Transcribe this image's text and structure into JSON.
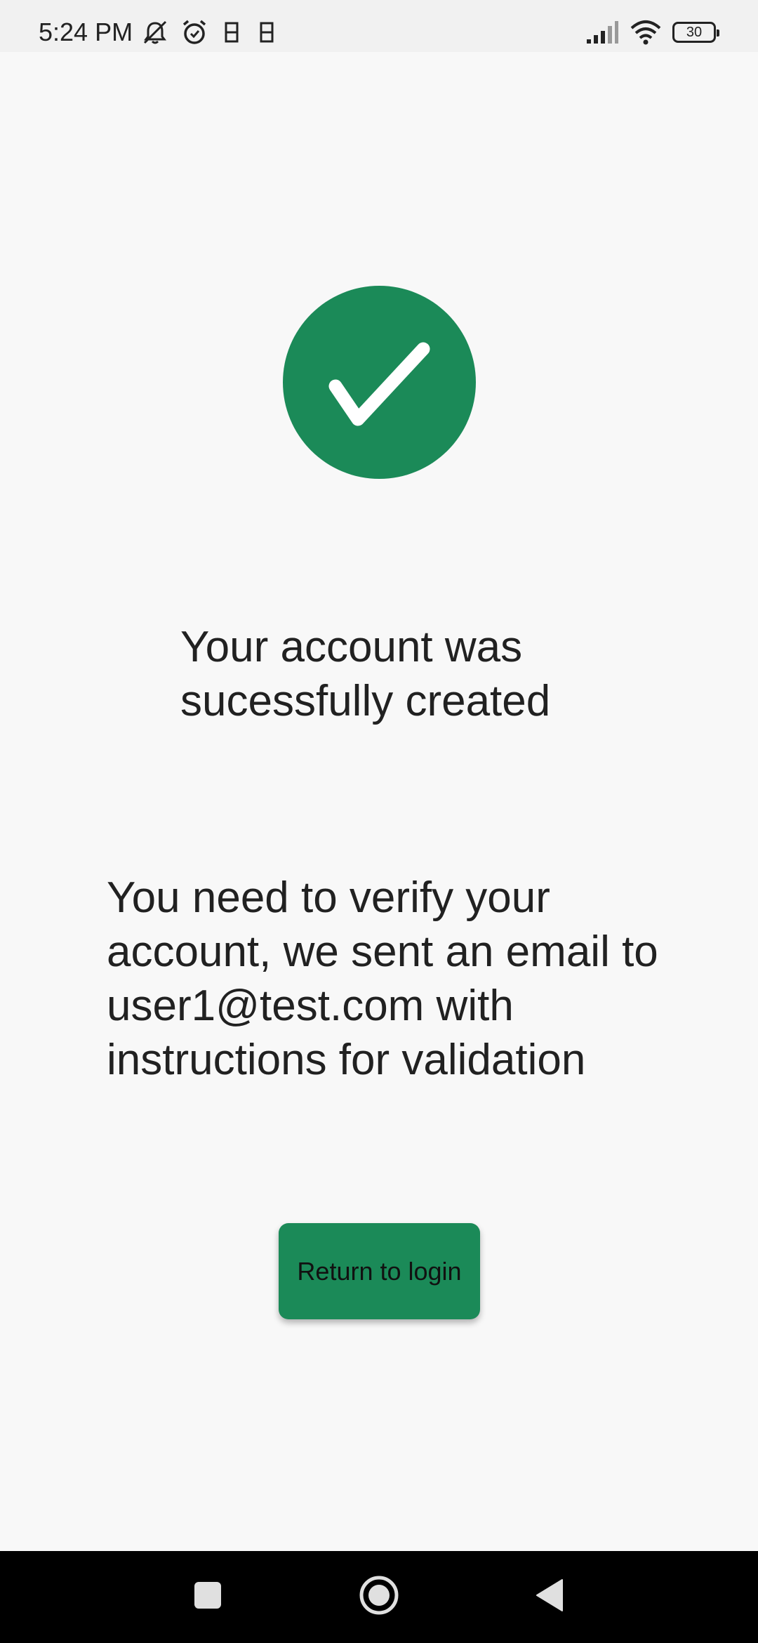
{
  "status_bar": {
    "time": "5:24 PM",
    "battery_level": "30",
    "left_icons": [
      "bell-off-icon",
      "alarm-icon",
      "sim-icon",
      "sim-icon"
    ],
    "right_icons": [
      "signal-icon",
      "wifi-icon",
      "battery-icon"
    ]
  },
  "success": {
    "icon": "check-circle-icon",
    "color": "#1b8a58"
  },
  "title": "Your account was sucessfully created",
  "message": "You need to verify your account, we sent an email to user1@test.com with instructions for validation",
  "actions": {
    "return_label": "Return to login"
  },
  "nav_bar": {
    "buttons": [
      "recents-square-icon",
      "home-circle-icon",
      "back-triangle-icon"
    ]
  }
}
